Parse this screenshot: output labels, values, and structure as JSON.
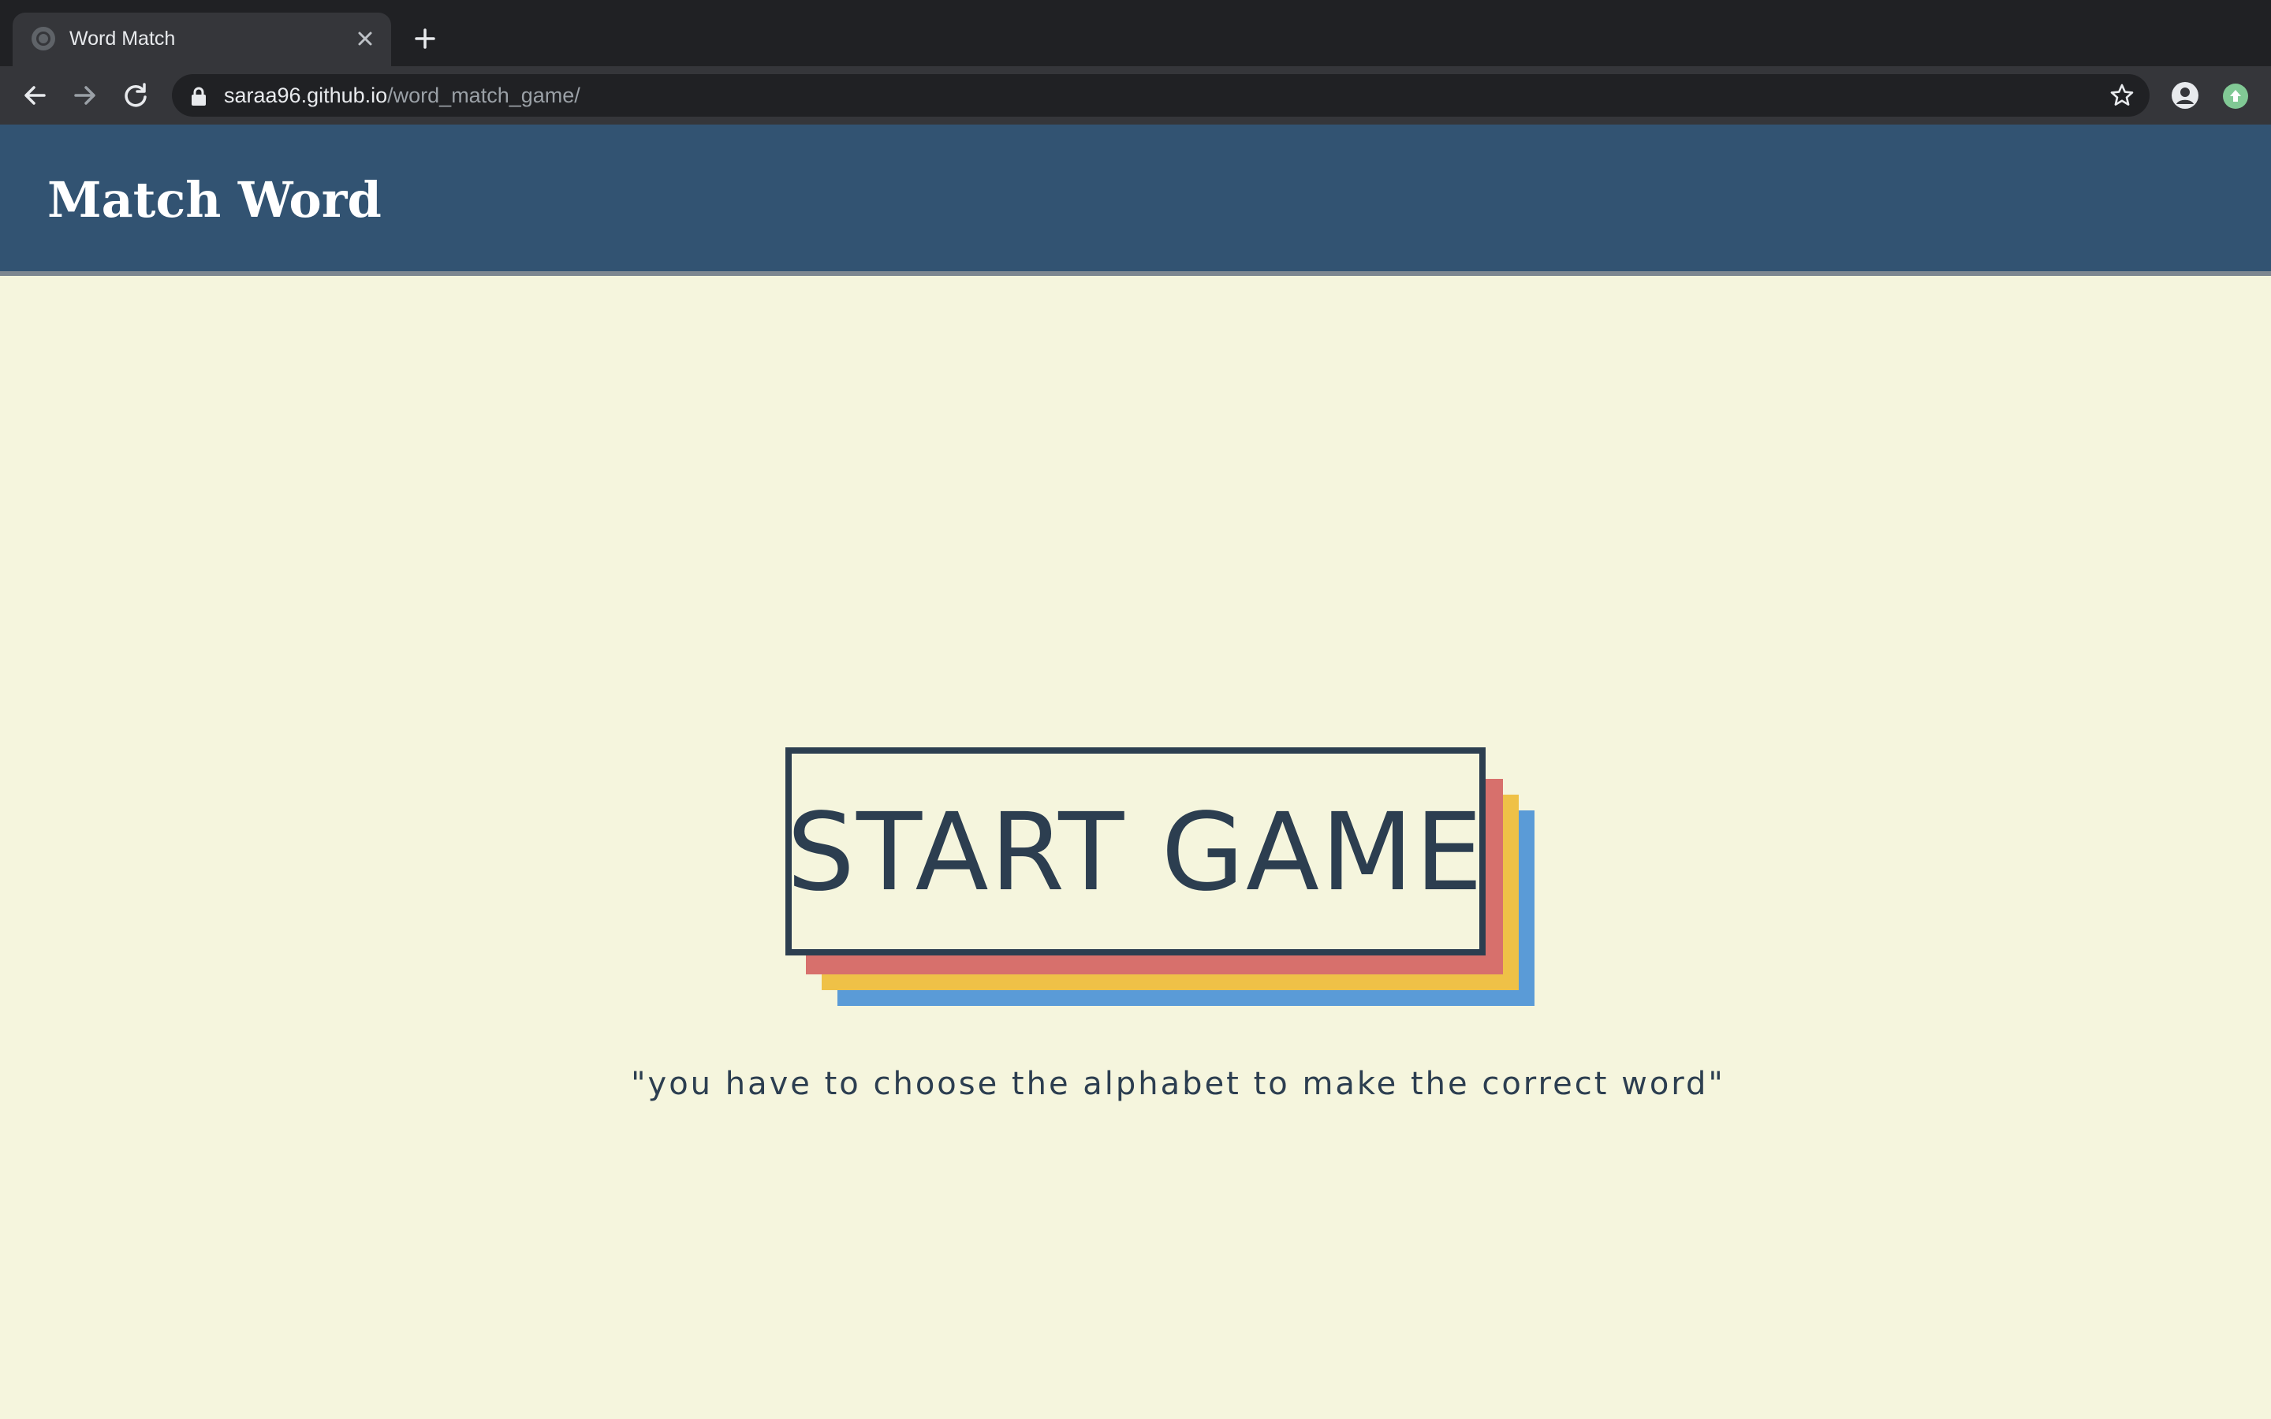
{
  "browser": {
    "tab": {
      "title": "Word Match",
      "favicon_icon": "globe-icon",
      "close_icon": "close-icon"
    },
    "new_tab_icon": "plus-icon",
    "toolbar": {
      "back_icon": "arrow-left-icon",
      "forward_icon": "arrow-right-icon",
      "reload_icon": "reload-icon",
      "lock_icon": "lock-icon",
      "url_host": "saraa96.github.io",
      "url_path": "/word_match_game/",
      "bookmark_icon": "star-icon",
      "profile_icon": "account-circle-icon",
      "extension_icon": "update-arrow-icon"
    }
  },
  "page": {
    "header": {
      "title": "Match Word"
    },
    "start_button": {
      "label": "START GAME"
    },
    "instruction": "\"you have to choose the alphabet to make the correct word\""
  },
  "colors": {
    "background": "#f5f5dd",
    "header": "#325372",
    "text_dark": "#2c3e50",
    "layer_red": "#d7706c",
    "layer_yellow": "#efc147",
    "layer_blue": "#5a9bd7"
  }
}
